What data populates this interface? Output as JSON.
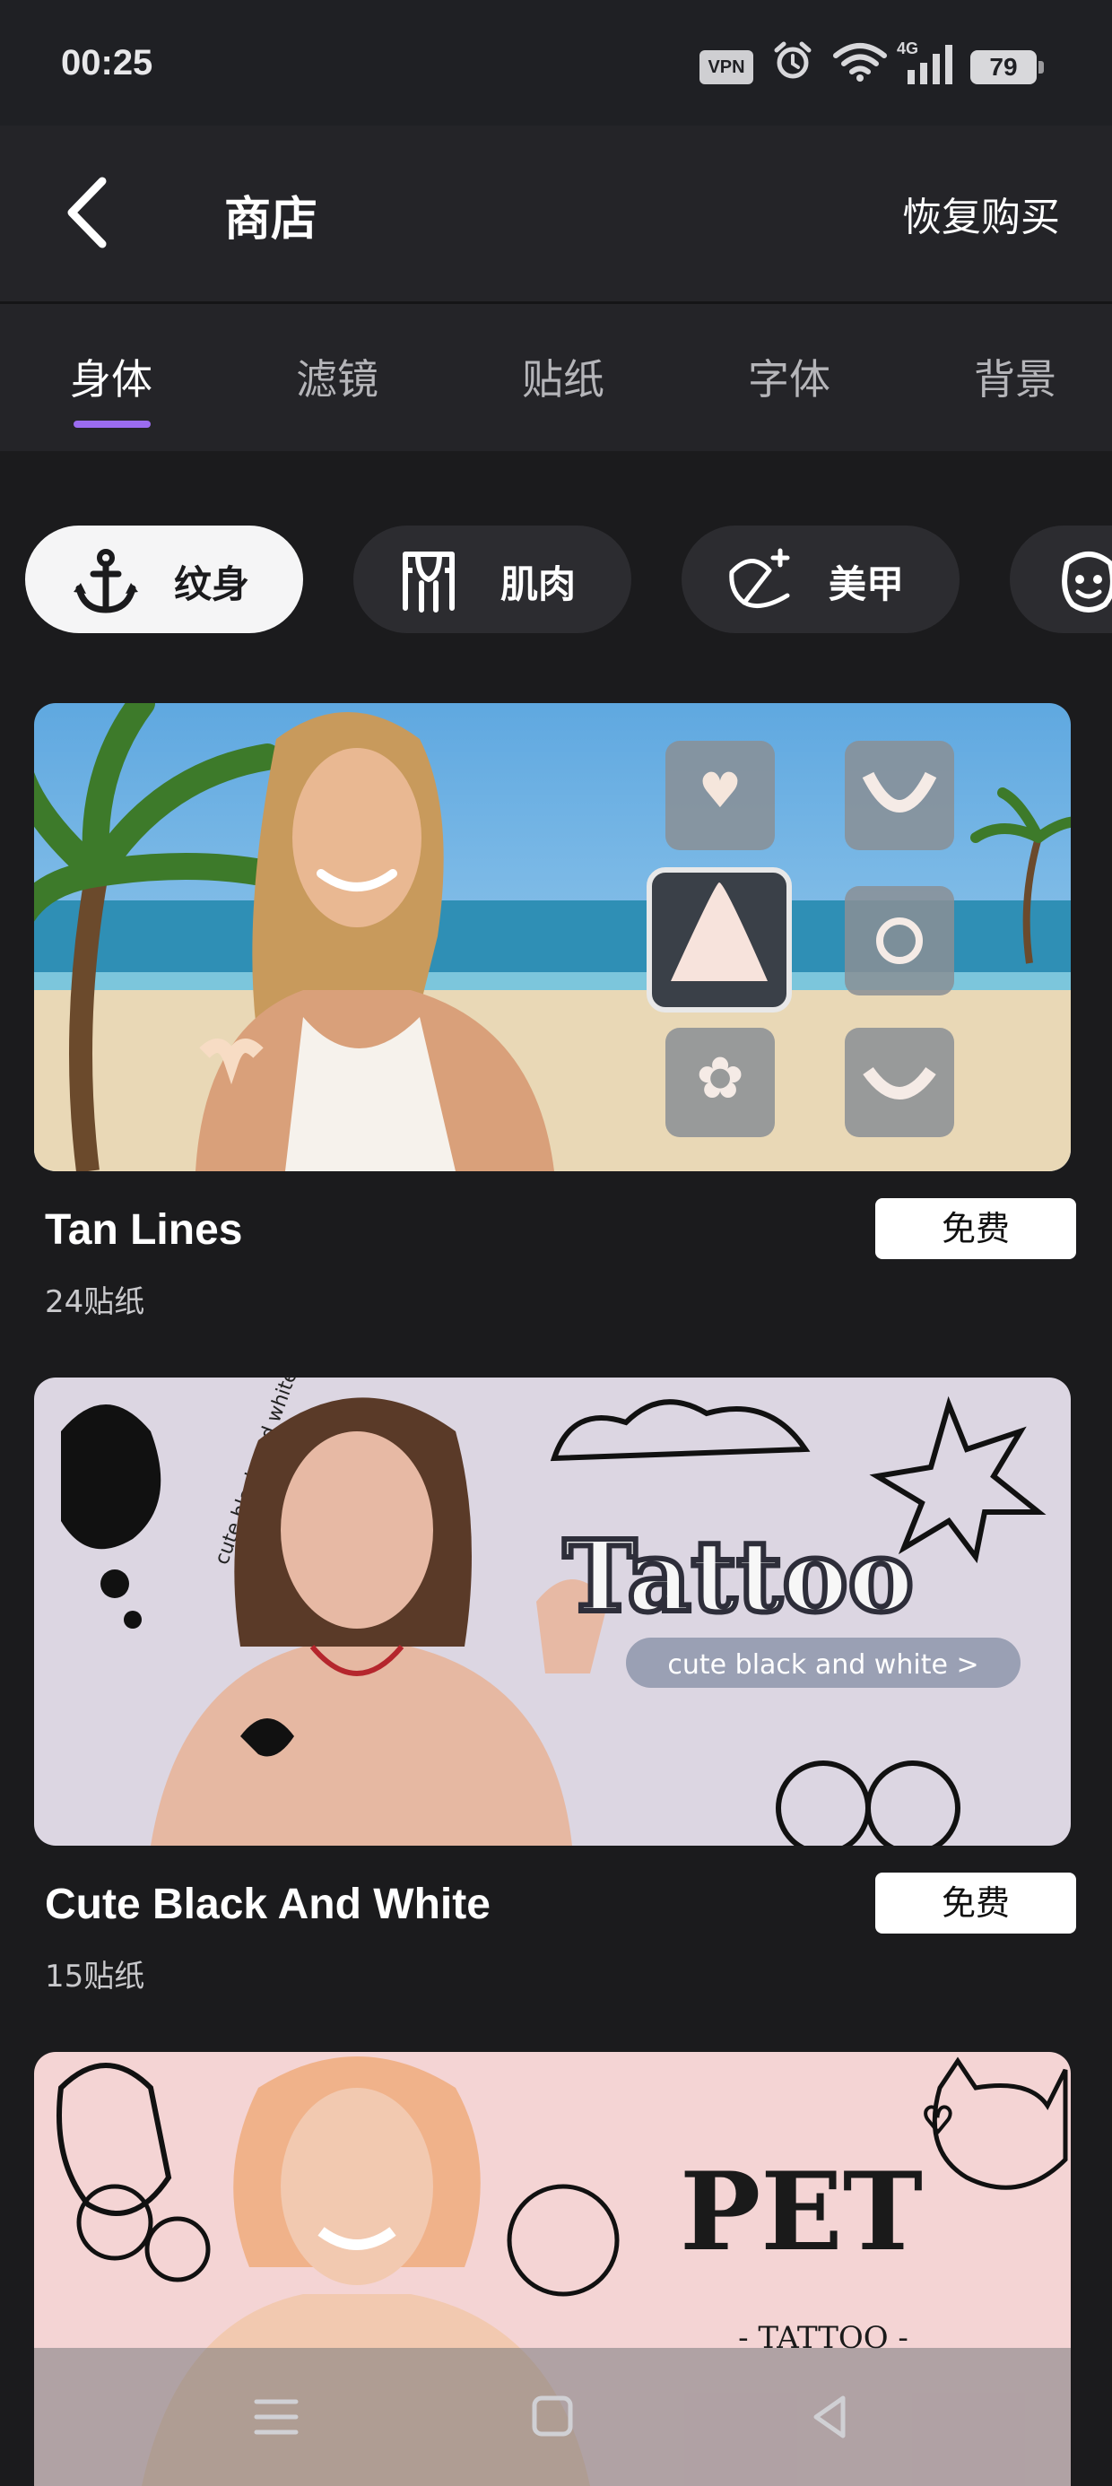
{
  "status_bar": {
    "time": "00:25",
    "vpn_label": "VPN",
    "network": "4G",
    "battery": "79"
  },
  "header": {
    "title": "商店",
    "restore_label": "恢复购买"
  },
  "tabs": [
    {
      "label": "身体",
      "active": true
    },
    {
      "label": "滤镜",
      "active": false
    },
    {
      "label": "贴纸",
      "active": false
    },
    {
      "label": "字体",
      "active": false
    },
    {
      "label": "背景",
      "active": false
    }
  ],
  "chips": [
    {
      "label": "纹身",
      "icon": "anchor-icon",
      "active": true
    },
    {
      "label": "肌肉",
      "icon": "muscle-shirt-icon",
      "active": false
    },
    {
      "label": "美甲",
      "icon": "nail-brush-icon",
      "active": false
    },
    {
      "label": "",
      "icon": "face-icon",
      "active": false
    }
  ],
  "cards": [
    {
      "title": "Tan Lines",
      "subtitle": "24贴纸",
      "price_label": "免费",
      "image": "tan-lines-banner"
    },
    {
      "title": "Cute Black And White",
      "subtitle": "15贴纸",
      "price_label": "免费",
      "image": "tattoo-banner",
      "banner_heading": "Tattoo",
      "banner_tagline": "cute black and white >",
      "banner_side_text": "cute black and white >"
    },
    {
      "title": "",
      "subtitle": "",
      "price_label": "",
      "image": "pet-tattoo-banner",
      "banner_heading": "PET",
      "banner_subheading": "- TATTOO -"
    }
  ],
  "colors": {
    "background": "#1b1b1d",
    "header": "#242428",
    "accent": "#9b6cf0",
    "chip": "#2c2c30",
    "chip_active": "#f5f5f6"
  }
}
